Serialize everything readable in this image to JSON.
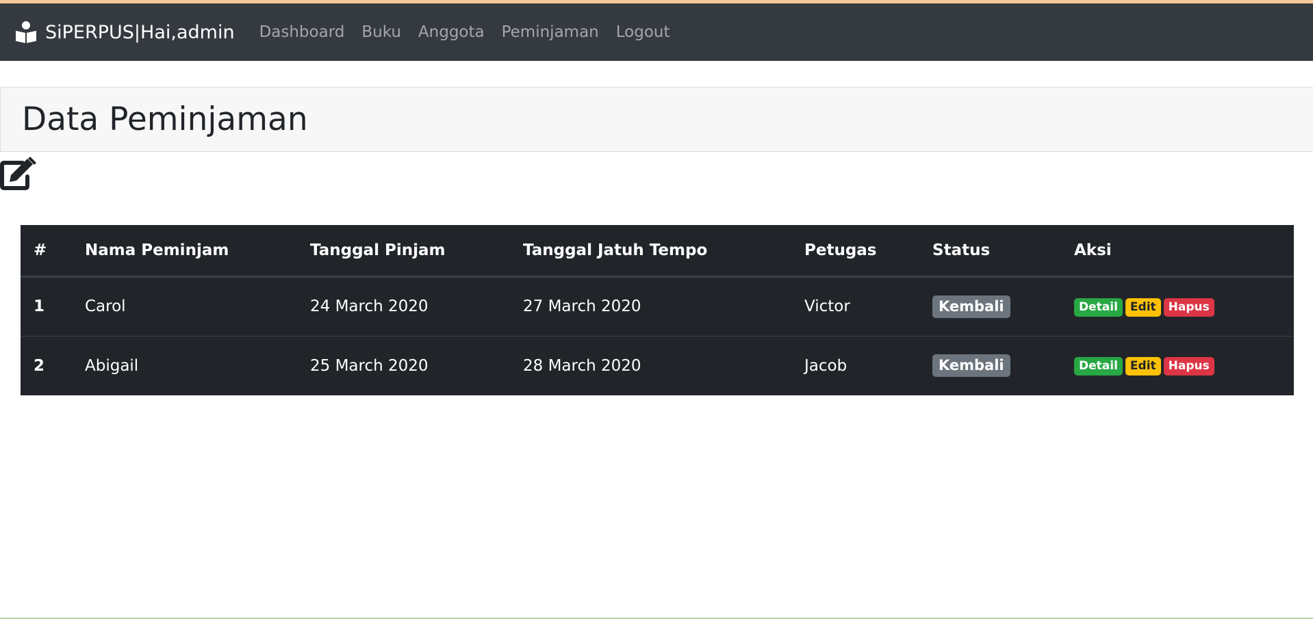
{
  "navbar": {
    "brand": "SiPERPUS|Hai,admin",
    "brand_icon": "reader-icon",
    "links": [
      "Dashboard",
      "Buku",
      "Anggota",
      "Peminjaman",
      "Logout"
    ]
  },
  "page": {
    "title": "Data Peminjaman",
    "add_icon": "edit-icon"
  },
  "table": {
    "headers": [
      "#",
      "Nama Peminjam",
      "Tanggal Pinjam",
      "Tanggal Jatuh Tempo",
      "Petugas",
      "Status",
      "Aksi"
    ],
    "rows": [
      {
        "no": "1",
        "nama": "Carol",
        "tanggal_pinjam": "24 March 2020",
        "jatuh_tempo": "27 March 2020",
        "petugas": "Victor",
        "status": "Kembali",
        "actions": [
          "Detail",
          "Edit",
          "Hapus"
        ]
      },
      {
        "no": "2",
        "nama": "Abigail",
        "tanggal_pinjam": "25 March 2020",
        "jatuh_tempo": "28 March 2020",
        "petugas": "Jacob",
        "status": "Kembali",
        "actions": [
          "Detail",
          "Edit",
          "Hapus"
        ]
      }
    ]
  },
  "colors": {
    "navbar_bg": "#343a40",
    "table_bg": "#212529",
    "status_badge": "#6c757d",
    "detail_badge": "#28a745",
    "edit_badge": "#ffc107",
    "hapus_badge": "#dc3545"
  }
}
